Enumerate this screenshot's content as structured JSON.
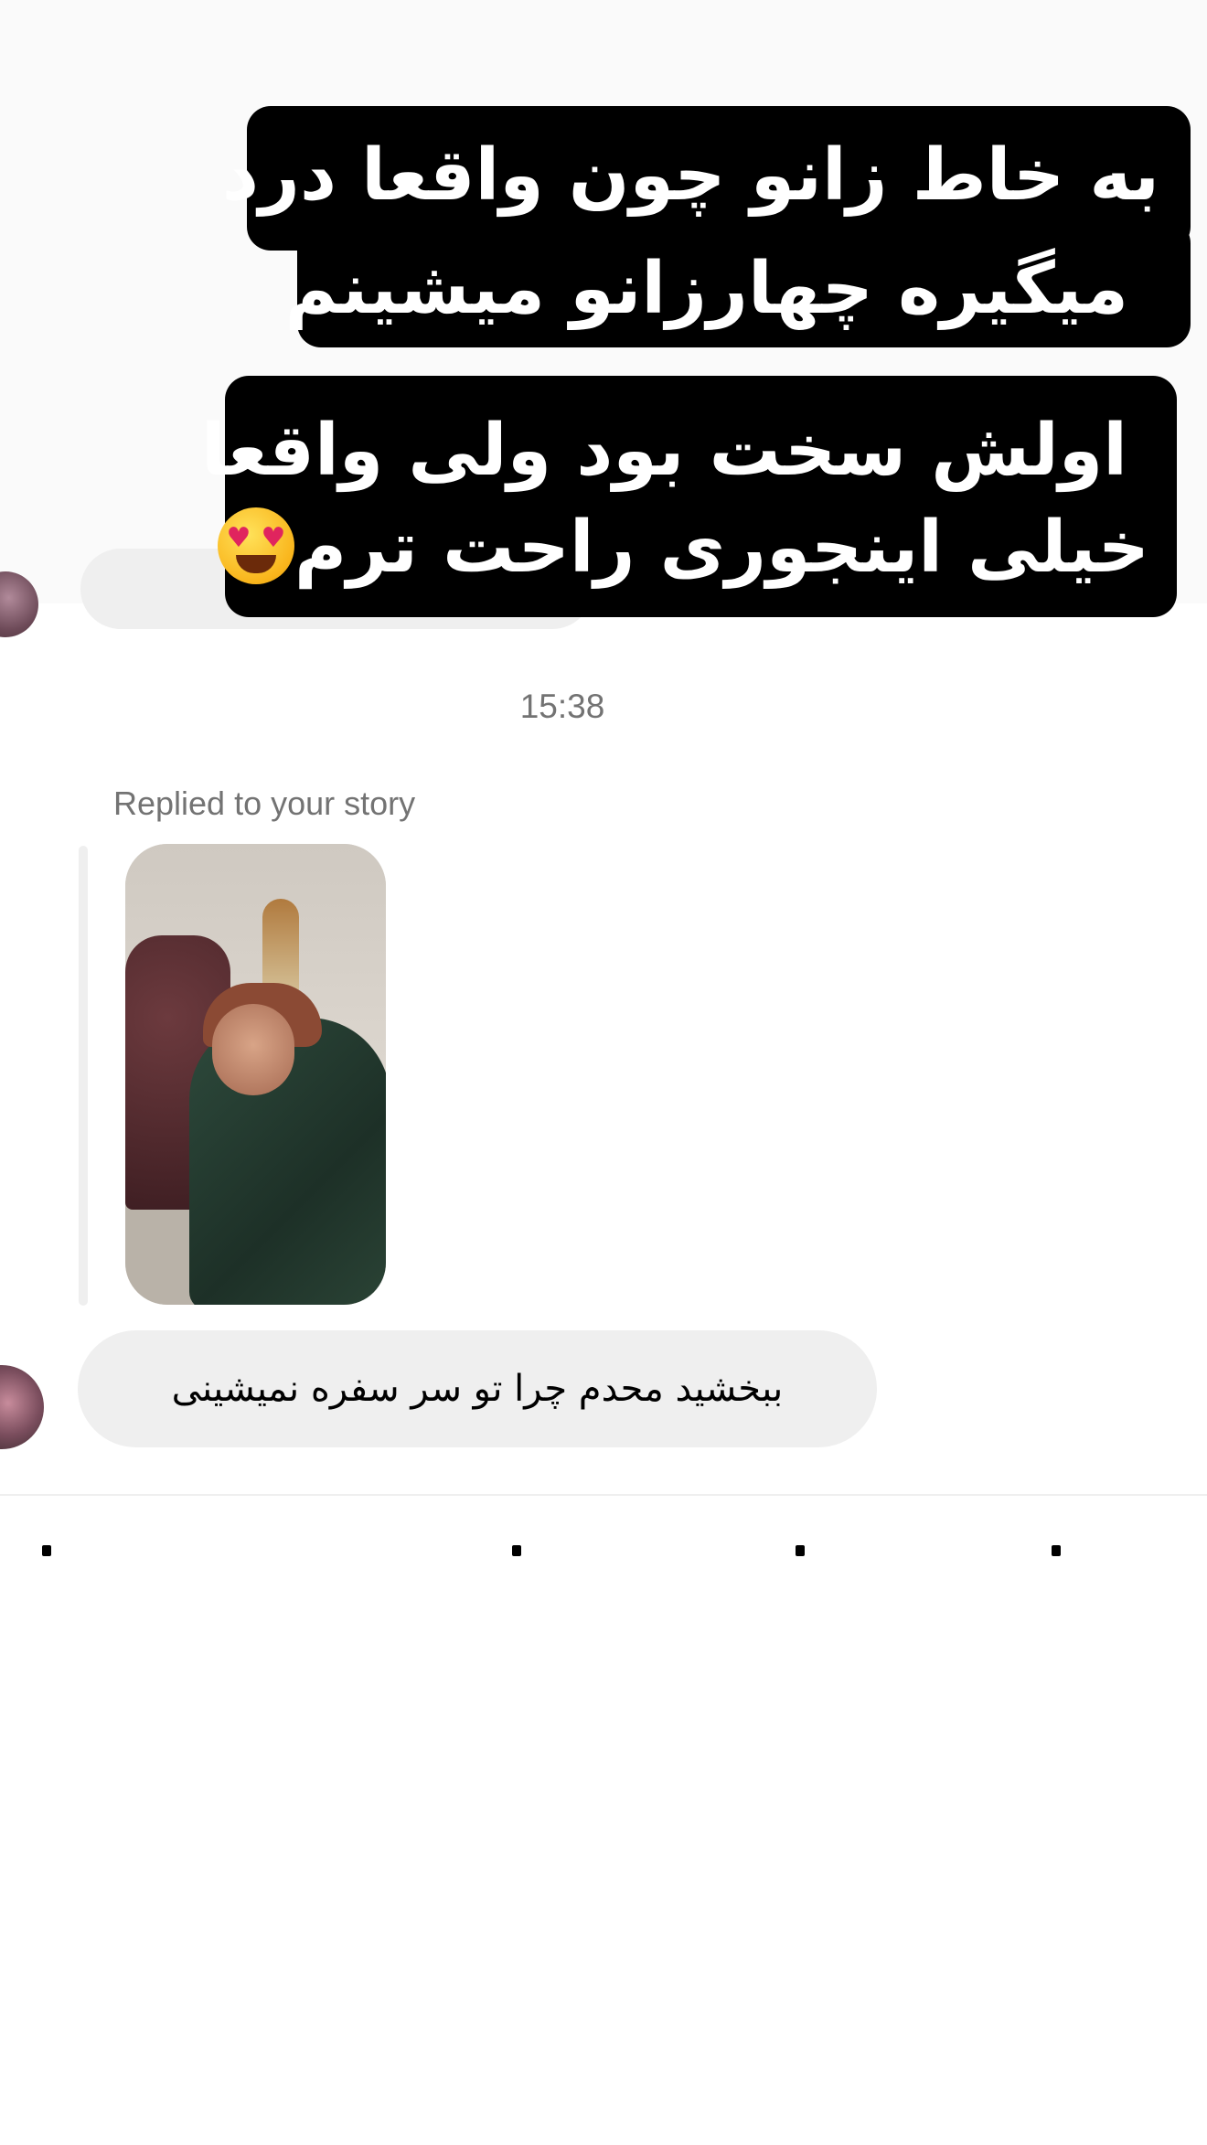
{
  "story_caption": {
    "line1": "به خاط زانو چون واقعا  درد",
    "line2": "میگیره چهارزانو میشینم",
    "line3": "اولش سخت بود ولی واقعا",
    "line4": "خیلی اینجوری راحت ترم"
  },
  "thread": {
    "timestamp": "15:38",
    "replied_label": "Replied to your story",
    "message_text": "ببخشید محدم چرا تو سر سفره نمیشینی"
  },
  "colors": {
    "bubble_bg": "#efefef",
    "meta_text": "#737373",
    "caption_bg": "#000000",
    "caption_text": "#ffffff"
  },
  "icons": {
    "emoji": "heart-eyes-emoji"
  }
}
